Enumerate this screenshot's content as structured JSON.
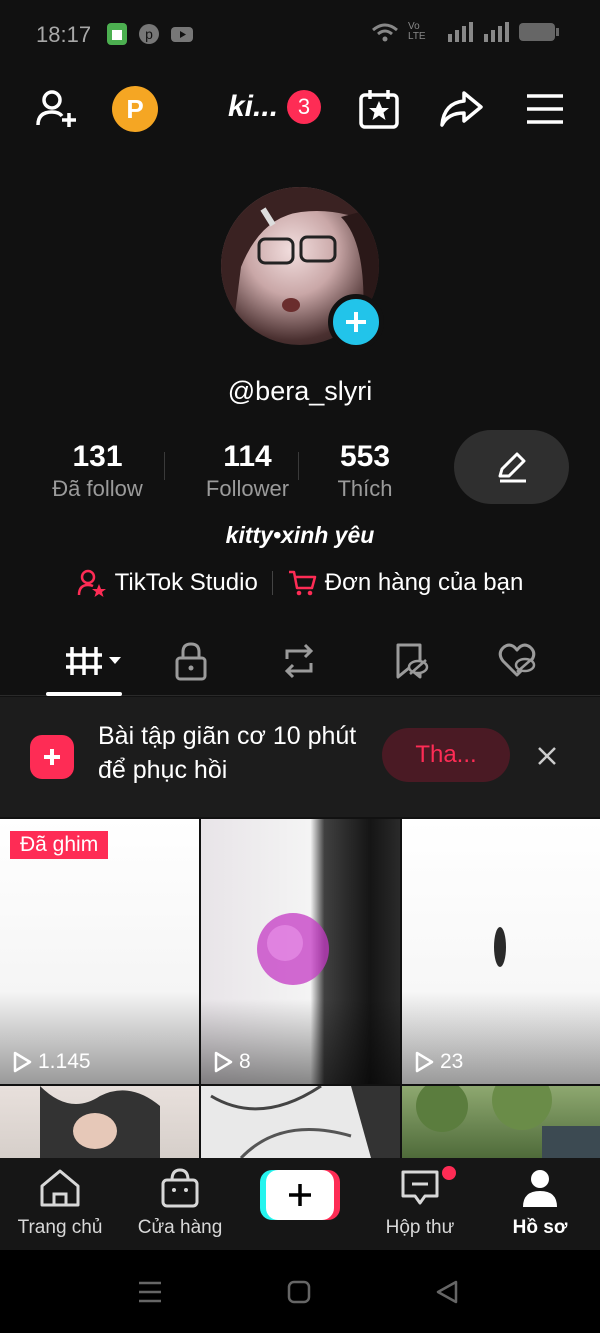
{
  "status_bar": {
    "time": "18:17",
    "network_label": "Vo LTE"
  },
  "header": {
    "points_letter": "P",
    "profile_name": "ki...",
    "notification_count": "3"
  },
  "profile": {
    "username": "@bera_slyri",
    "stats": [
      {
        "value": "131",
        "label": "Đã follow"
      },
      {
        "value": "114",
        "label": "Follower"
      },
      {
        "value": "553",
        "label": "Thích"
      }
    ],
    "bio": "kitty•xinh yêu",
    "links": {
      "studio": "TikTok Studio",
      "orders": "Đơn hàng của bạn"
    }
  },
  "promo": {
    "text": "Bài tập giãn cơ 10 phút để phục hồi",
    "button": "Tha..."
  },
  "videos": [
    {
      "views": "1.145",
      "pinned_label": "Đã ghim"
    },
    {
      "views": "8"
    },
    {
      "views": "23"
    }
  ],
  "bottom_nav": {
    "home": "Trang chủ",
    "shop": "Cửa hàng",
    "inbox": "Hộp thư",
    "profile": "Hồ sơ"
  },
  "colors": {
    "accent": "#fe2c55",
    "cyan": "#25f4ee",
    "background": "#111111"
  }
}
